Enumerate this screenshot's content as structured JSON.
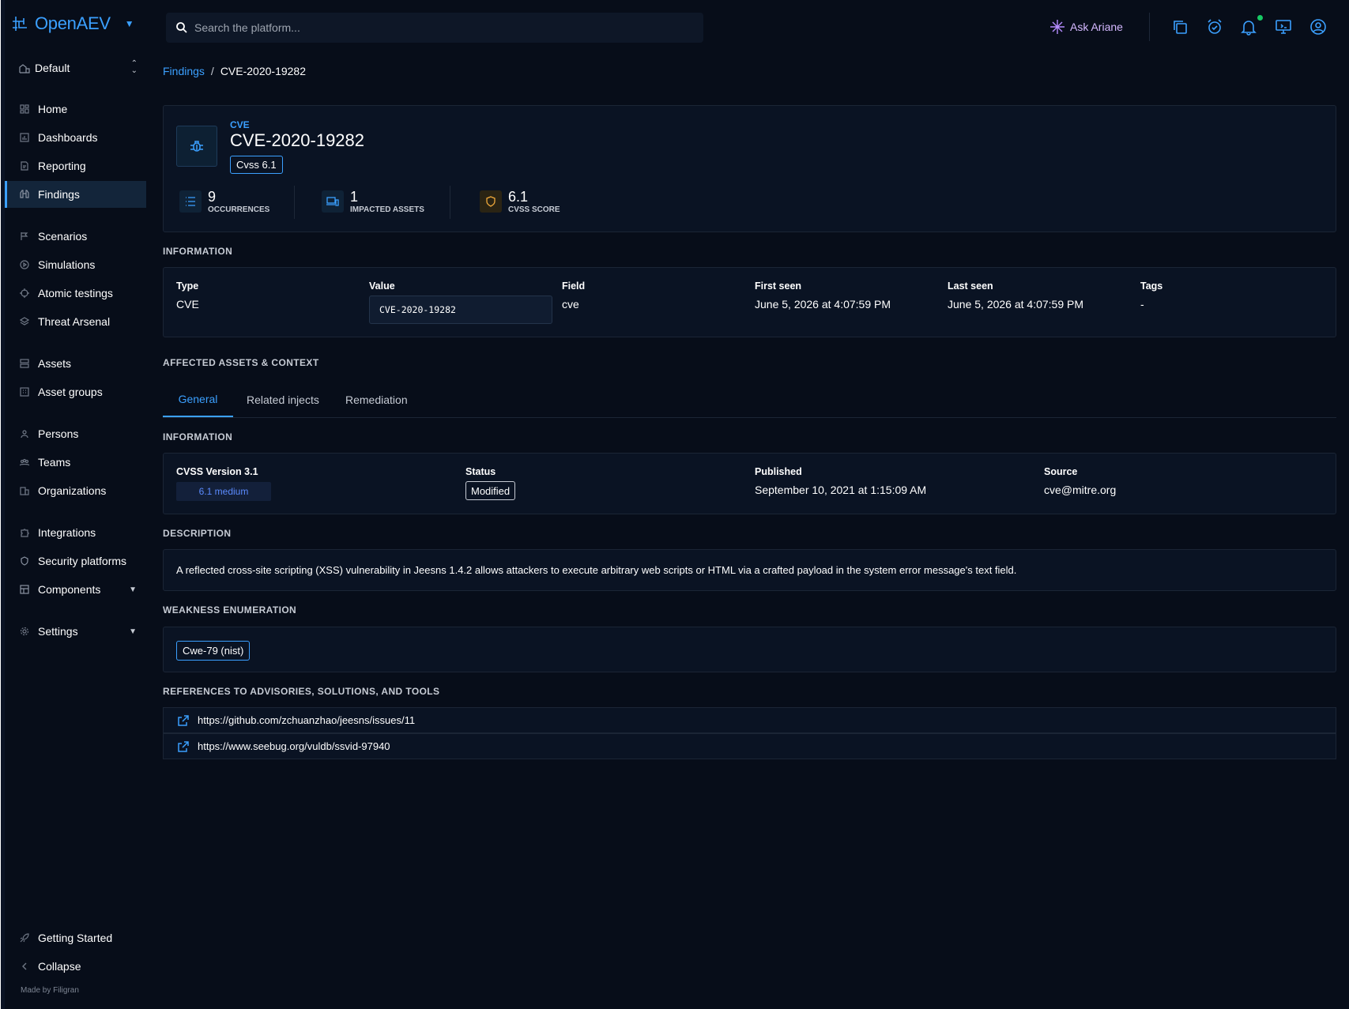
{
  "app": {
    "name": "OpenAEV",
    "workspace": "Default",
    "made_by": "Made by Filigran"
  },
  "search": {
    "placeholder": "Search the platform..."
  },
  "topbar": {
    "ask_ariane": "Ask Ariane"
  },
  "sidebar": {
    "items": [
      {
        "label": "Home",
        "icon": "home-icon"
      },
      {
        "label": "Dashboards",
        "icon": "dashboard-icon"
      },
      {
        "label": "Reporting",
        "icon": "report-icon"
      },
      {
        "label": "Findings",
        "icon": "binoculars-icon",
        "active": true
      },
      {
        "label": "Scenarios",
        "icon": "scenario-icon"
      },
      {
        "label": "Simulations",
        "icon": "play-circle-icon"
      },
      {
        "label": "Atomic testings",
        "icon": "target-icon"
      },
      {
        "label": "Threat Arsenal",
        "icon": "layers-icon"
      },
      {
        "label": "Assets",
        "icon": "server-icon"
      },
      {
        "label": "Asset groups",
        "icon": "grid-icon"
      },
      {
        "label": "Persons",
        "icon": "person-icon"
      },
      {
        "label": "Teams",
        "icon": "team-icon"
      },
      {
        "label": "Organizations",
        "icon": "building-icon"
      },
      {
        "label": "Integrations",
        "icon": "puzzle-icon"
      },
      {
        "label": "Security platforms",
        "icon": "shield-icon"
      },
      {
        "label": "Components",
        "icon": "components-icon"
      },
      {
        "label": "Settings",
        "icon": "gear-icon"
      },
      {
        "label": "Getting Started",
        "icon": "rocket-icon"
      },
      {
        "label": "Collapse",
        "icon": "chevron-left-icon"
      }
    ]
  },
  "breadcrumb": {
    "parent": "Findings",
    "current": "CVE-2020-19282"
  },
  "header": {
    "kicker": "CVE",
    "title": "CVE-2020-19282",
    "cvss_chip": "Cvss 6.1",
    "stats": [
      {
        "value": "9",
        "label": "OCCURRENCES"
      },
      {
        "value": "1",
        "label": "IMPACTED ASSETS"
      },
      {
        "value": "6.1",
        "label": "CVSS SCORE"
      }
    ]
  },
  "information": {
    "title": "INFORMATION",
    "type_label": "Type",
    "type_value": "CVE",
    "value_label": "Value",
    "value_value": "CVE-2020-19282",
    "field_label": "Field",
    "field_value": "cve",
    "first_seen_label": "First seen",
    "first_seen_value": "June 5, 2026 at 4:07:59 PM",
    "last_seen_label": "Last seen",
    "last_seen_value": "June 5, 2026 at 4:07:59 PM",
    "tags_label": "Tags",
    "tags_value": "-"
  },
  "affected": {
    "title": "AFFECTED ASSETS & CONTEXT",
    "tabs": [
      "General",
      "Related injects",
      "Remediation"
    ]
  },
  "general_info": {
    "title": "INFORMATION",
    "cvss_version_label": "CVSS Version 3.1",
    "cvss_badge": "6.1 medium",
    "status_label": "Status",
    "status_value": "Modified",
    "published_label": "Published",
    "published_value": "September 10, 2021 at 1:15:09 AM",
    "source_label": "Source",
    "source_value": "cve@mitre.org"
  },
  "description": {
    "title": "DESCRIPTION",
    "text": "A reflected cross-site scripting (XSS) vulnerability in Jeesns 1.4.2 allows attackers to execute arbitrary web scripts or HTML via a crafted payload in the system error message's text field."
  },
  "weakness": {
    "title": "WEAKNESS ENUMERATION",
    "chip": "Cwe-79 (nist)"
  },
  "references": {
    "title": "REFERENCES TO ADVISORIES, SOLUTIONS, AND TOOLS",
    "links": [
      "https://github.com/zchuanzhao/jeesns/issues/11",
      "https://www.seebug.org/vuldb/ssvid-97940"
    ]
  },
  "colors": {
    "accent": "#3ba0ff",
    "background": "#070d19",
    "card": "#0a1323",
    "ariane": "#d4b8ff",
    "notification_dot": "#17c964",
    "cvss_shield": "#f0a93b"
  }
}
